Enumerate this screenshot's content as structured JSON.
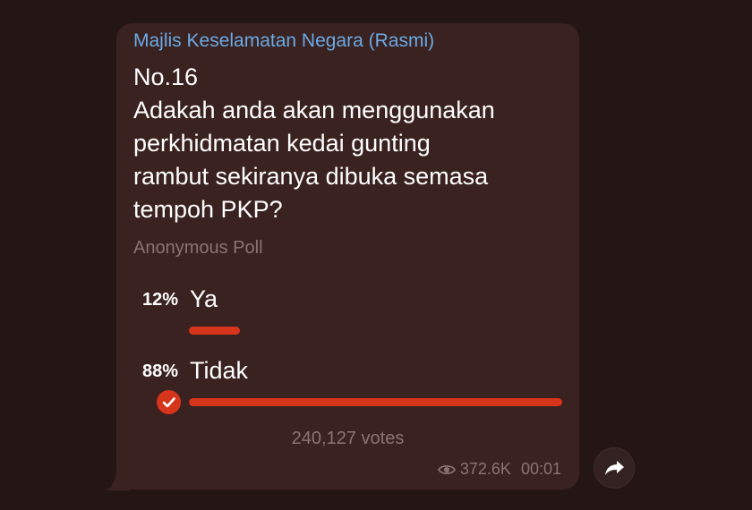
{
  "message": {
    "channel_name": "Majlis Keselamatan Negara (Rasmi)",
    "question_lines": [
      "No.16",
      "Adakah anda akan menggunakan",
      "perkhidmatan kedai gunting",
      "rambut sekiranya dibuka semasa",
      "tempoh PKP?"
    ],
    "poll_type": "Anonymous Poll",
    "options": [
      {
        "percent_text": "12%",
        "label": "Ya",
        "fraction": 0.12,
        "selected": false
      },
      {
        "percent_text": "88%",
        "label": "Tidak",
        "fraction": 0.88,
        "selected": true
      }
    ],
    "votes": "240,127 votes",
    "views": "372.6K",
    "time": "00:01"
  },
  "icons": {
    "views": "eye-icon",
    "selected": "check-circle-icon",
    "share": "share-arrow-icon"
  },
  "colors": {
    "background": "#251616",
    "bubble": "#3a2220",
    "channel_name": "#6aaae6",
    "bar": "#d7341c",
    "muted": "#8a7470"
  }
}
